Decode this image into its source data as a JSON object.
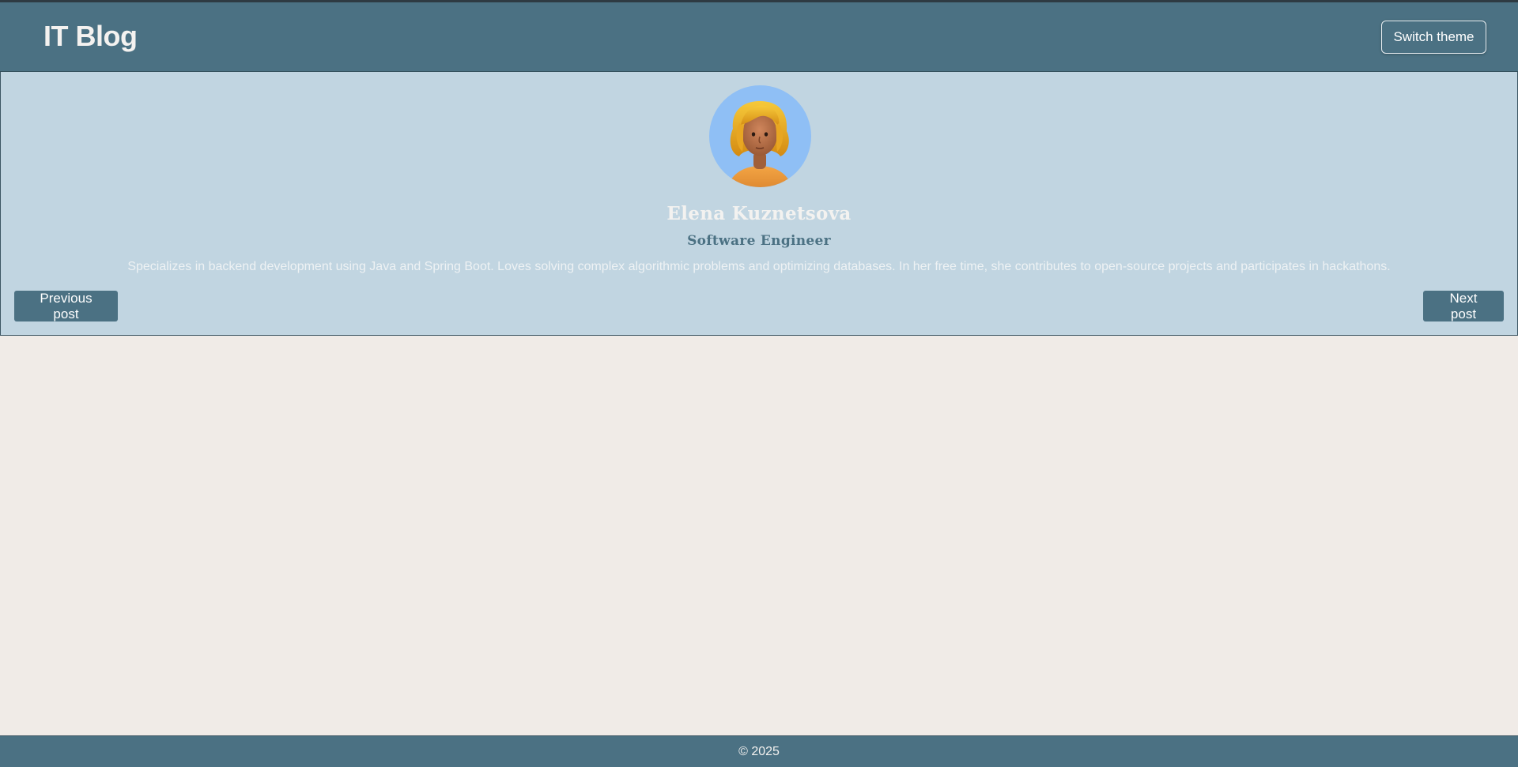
{
  "header": {
    "title": "IT Blog",
    "theme_button_label": "Switch theme"
  },
  "author": {
    "name": "Elena Kuznetsova",
    "role": "Software Engineer",
    "bio": "Specializes in backend development using Java and Spring Boot. Loves solving complex algorithmic problems and optimizing databases. In her free time, she contributes to open-source projects and participates in hackathons.",
    "avatar_icon": "avatar-illustration-icon",
    "avatar_bg_color": "#8fbff5"
  },
  "navigation": {
    "previous_label": "Previous post",
    "next_label": "Next post"
  },
  "footer": {
    "copyright": "© 2025"
  },
  "colors": {
    "primary": "#4b7183",
    "card_background": "#c1d5e1",
    "page_background": "#f0ebe7"
  }
}
